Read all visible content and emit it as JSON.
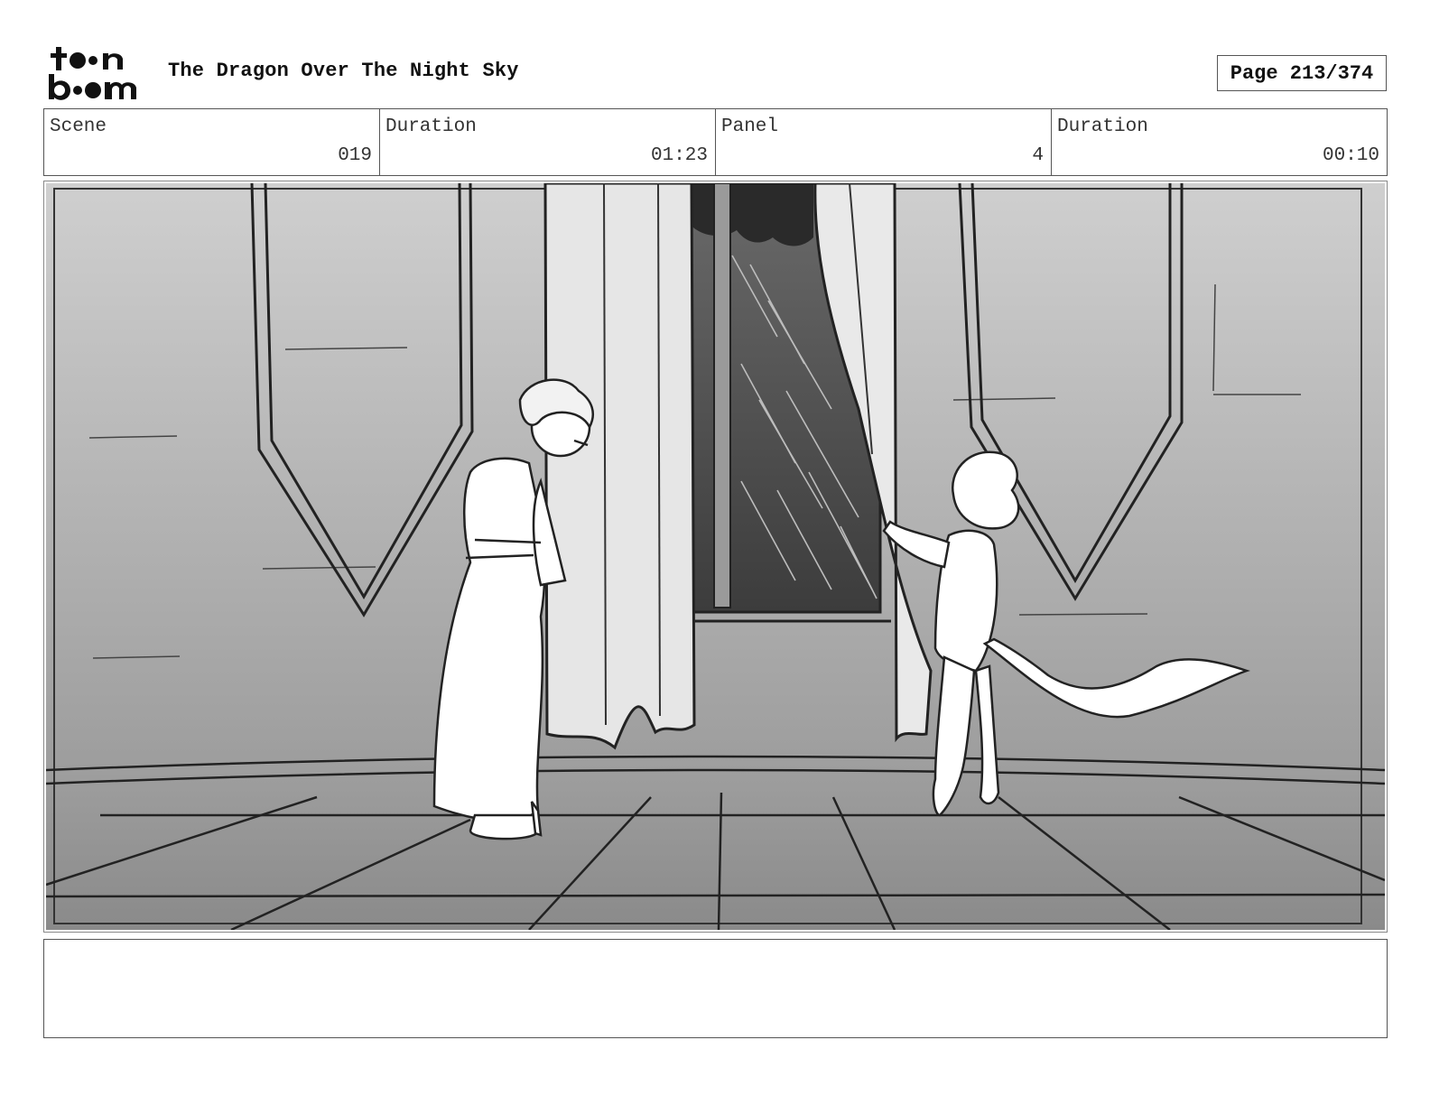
{
  "header": {
    "logo_text": "toonboom",
    "title": "The Dragon Over The Night Sky",
    "page": "Page 213/374"
  },
  "info": {
    "scene_label": "Scene",
    "scene_value": "019",
    "scene_duration_label": "Duration",
    "scene_duration_value": "01:23",
    "panel_label": "Panel",
    "panel_value": "4",
    "panel_duration_label": "Duration",
    "panel_duration_value": "00:10"
  },
  "notes": {
    "text": ""
  }
}
